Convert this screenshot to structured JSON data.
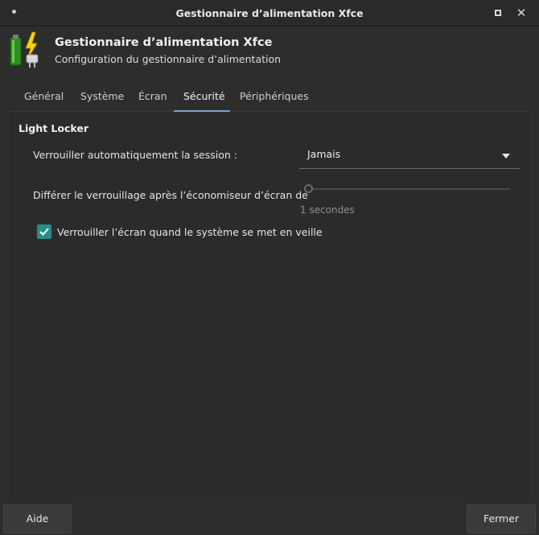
{
  "window": {
    "title": "Gestionnaire d’alimentation Xfce"
  },
  "header": {
    "title": "Gestionnaire d’alimentation Xfce",
    "subtitle": "Configuration du gestionnaire d’alimentation",
    "icon": "battery-power-plug-icon"
  },
  "tabs": [
    {
      "label": "Général"
    },
    {
      "label": "Système"
    },
    {
      "label": "Écran"
    },
    {
      "label": "Sécurité"
    },
    {
      "label": "Périphériques"
    }
  ],
  "active_tab": "Sécurité",
  "security": {
    "section_title": "Light Locker",
    "auto_lock_label": "Verrouiller automatiquement la session :",
    "auto_lock_value": "Jamais",
    "delay_label": "Différer le verrouillage après l’économiseur d’écran de",
    "delay_value_text": "1 secondes",
    "delay_value": 1,
    "lock_on_sleep_label": "Verrouiller l’écran quand le système se met en veille",
    "lock_on_sleep_checked": true
  },
  "footer": {
    "help_label": "Aide",
    "close_label": "Fermer"
  },
  "colors": {
    "accent": "#2a8c87",
    "tab_underline": "#6fa7d8"
  }
}
